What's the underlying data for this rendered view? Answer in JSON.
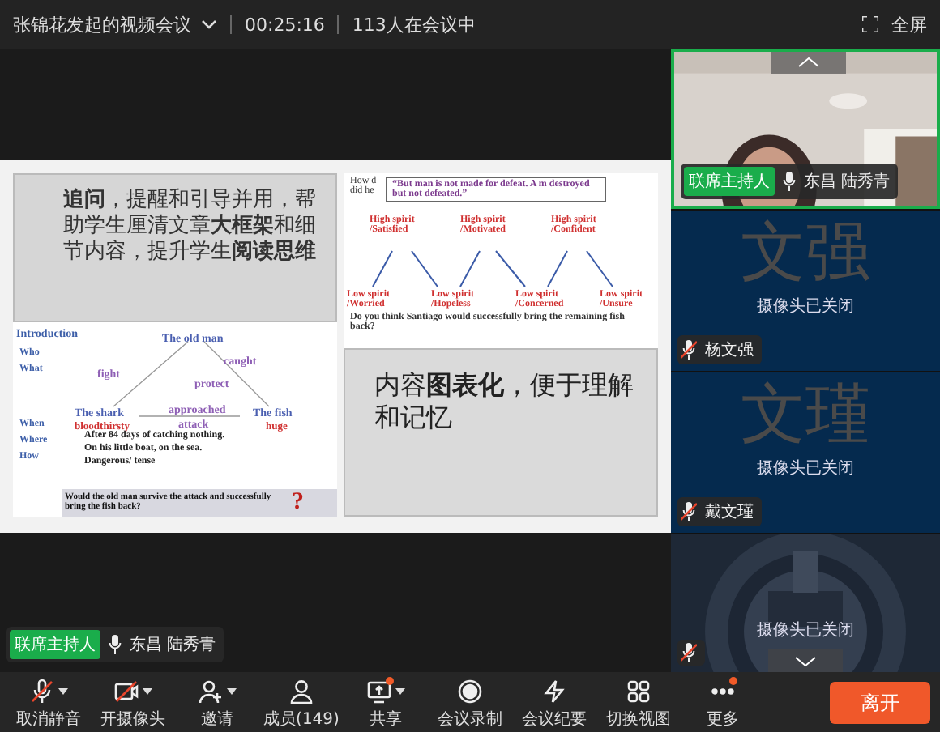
{
  "header": {
    "title": "张锦花发起的视频会议",
    "time": "00:25:16",
    "participants": "113人在会议中",
    "fullscreen": "全屏"
  },
  "slide": {
    "top_text": "**追问**，提醒和引导并用，帮助学生厘清文章**大框架**和细节内容，提升学生**阅读思维**",
    "intro": {
      "heading": "Introduction",
      "questions": [
        "Who",
        "What",
        "When",
        "Where",
        "How"
      ],
      "nodes": [
        {
          "text": "The old man",
          "kind": "node"
        },
        {
          "text": "fight",
          "kind": "verb"
        },
        {
          "text": "caught",
          "kind": "verb"
        },
        {
          "text": "protect",
          "kind": "verb"
        },
        {
          "text": "The shark",
          "kind": "node"
        },
        {
          "text": "bloodthirsty",
          "kind": "adj"
        },
        {
          "text": "approached",
          "kind": "verb"
        },
        {
          "text": "attack",
          "kind": "verb"
        },
        {
          "text": "The fish",
          "kind": "node"
        },
        {
          "text": "huge",
          "kind": "adj"
        }
      ],
      "answers": [
        "After **84** days of catching **nothing**.",
        "On his **little** boat, on the sea.",
        "**Dangerous/ tense**"
      ],
      "question": "Would the old man **survive the attack and successfully bring the fish back?**",
      "mark": "?"
    },
    "spirit": {
      "hidden_lines": [
        "How d",
        "did he"
      ],
      "quote": "“But man is not made for defeat. A m destroyed but not defeated.”",
      "labels": [
        "High spirit /Satisfied",
        "High spirit /Motivated",
        "High spirit /Confident",
        "Low spirit /Worried",
        "Low spirit /Hopeless",
        "Low spirit /Concerned",
        "Low spirit /Unsure"
      ],
      "question": "Do you think Santiago would **successfully** bring the remaining fish back?"
    },
    "bottom_text": "内容**图表化**，便于理解和记忆"
  },
  "tiles": [
    {
      "kind": "video",
      "badge": "联席主持人",
      "name": "东昌 陆秀青",
      "mic_muted": false,
      "speaking": true
    },
    {
      "kind": "avatar",
      "avatar_text": "文强",
      "status": "摄像头已关闭",
      "name": "杨文强",
      "mic_muted": true,
      "speaking": false
    },
    {
      "kind": "avatar",
      "avatar_text": "文瑾",
      "status": "摄像头已关闭",
      "name": "戴文瑾",
      "mic_muted": true,
      "speaking": false
    },
    {
      "kind": "logo",
      "status": "摄像头已关闭",
      "mic_muted": true,
      "speaking": false
    }
  ],
  "speaker_chip": {
    "badge": "联席主持人",
    "name": "东昌 陆秀青"
  },
  "toolbar": [
    {
      "label": "取消静音",
      "caret": true,
      "dot": false
    },
    {
      "label": "开摄像头",
      "caret": true,
      "dot": false
    },
    {
      "label": "邀请",
      "caret": true,
      "dot": false
    },
    {
      "label": "成员(149)",
      "caret": false,
      "dot": false
    },
    {
      "label": "共享",
      "caret": true,
      "dot": true
    },
    {
      "label": "会议录制",
      "caret": false,
      "dot": false
    },
    {
      "label": "会议纪要",
      "caret": false,
      "dot": false
    },
    {
      "label": "切换视图",
      "caret": false,
      "dot": false
    },
    {
      "label": "更多",
      "caret": false,
      "dot": true
    }
  ],
  "leave_button": "离开"
}
